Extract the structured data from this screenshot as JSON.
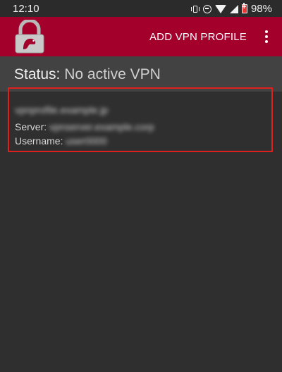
{
  "statusbar": {
    "time": "12:10",
    "battery": "98%"
  },
  "appbar": {
    "action_label": "ADD VPN PROFILE",
    "brand_color": "#a3002c"
  },
  "status": {
    "label": "Status:",
    "value": "No active VPN"
  },
  "profile": {
    "name": "vpnprofile.example.jp",
    "server_label": "Server:",
    "server_value": "vpnserver.example.corp",
    "username_label": "Username:",
    "username_value": "user0000"
  }
}
